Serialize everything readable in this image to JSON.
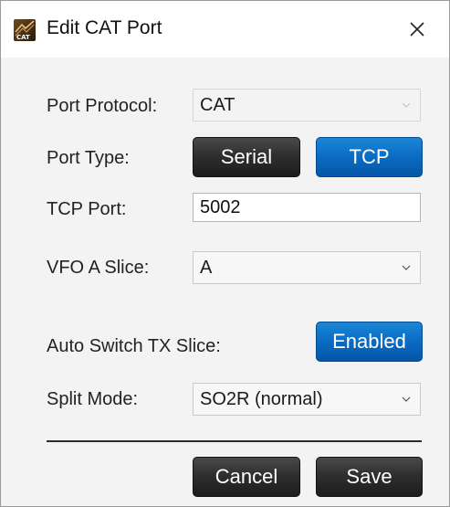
{
  "window": {
    "title": "Edit CAT Port",
    "icon": "cat-app-icon",
    "close_icon": "close-x-icon"
  },
  "form": {
    "port_protocol": {
      "label": "Port Protocol:",
      "value": "CAT"
    },
    "port_type": {
      "label": "Port Type:",
      "options": [
        "Serial",
        "TCP"
      ],
      "selected": "TCP"
    },
    "tcp_port": {
      "label": "TCP Port:",
      "value": "5002"
    },
    "vfo_a_slice": {
      "label": "VFO A Slice:",
      "value": "A"
    },
    "auto_switch_tx": {
      "label": "Auto Switch TX Slice:",
      "button": "Enabled"
    },
    "split_mode": {
      "label": "Split Mode:",
      "value": "SO2R (normal)"
    }
  },
  "actions": {
    "cancel_label": "Cancel",
    "save_label": "Save"
  },
  "colors": {
    "accent_blue": "#0a6cc2",
    "dark_button": "#2f2f2f",
    "background": "#f3f3f3"
  }
}
